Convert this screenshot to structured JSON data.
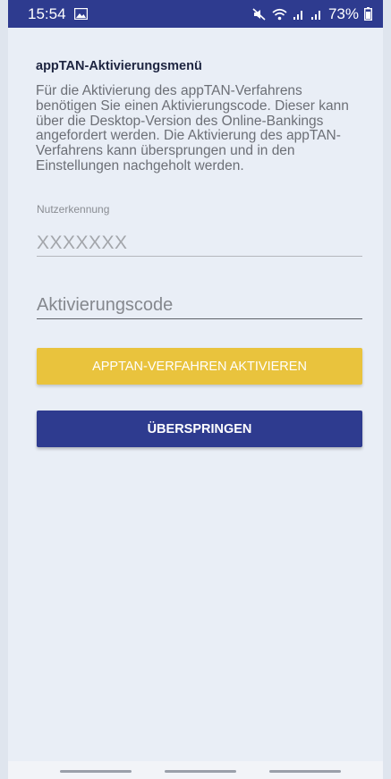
{
  "status_bar": {
    "time": "15:54",
    "battery": "73%",
    "icons": [
      "image-icon",
      "mute-icon",
      "wifi-icon",
      "signal-icon",
      "signal-icon",
      "battery-icon"
    ]
  },
  "activation_menu": {
    "title": "appTAN-Aktivierungsmenü",
    "description": "Für die Aktivierung des appTAN-Verfahrens benötigen Sie einen Aktivierungscode. Dieser kann über die Desktop-Version des Online-Bankings angefordert werden. Die Aktivierung des appTAN-Verfahrens kann übersprungen und in den Einstellungen nachgeholt werden.",
    "user_id": {
      "label": "Nutzerkennung",
      "placeholder": "XXXXXXX",
      "value": ""
    },
    "activation_code": {
      "placeholder": "Aktivierungscode",
      "value": ""
    },
    "activate_button_label": "APPTAN-VERFAHREN AKTIVIEREN",
    "skip_button_label": "ÜBERSPRINGEN"
  },
  "colors": {
    "primary": "#2e3b8f",
    "accent": "#e9c33d",
    "background": "#e9eef6"
  }
}
